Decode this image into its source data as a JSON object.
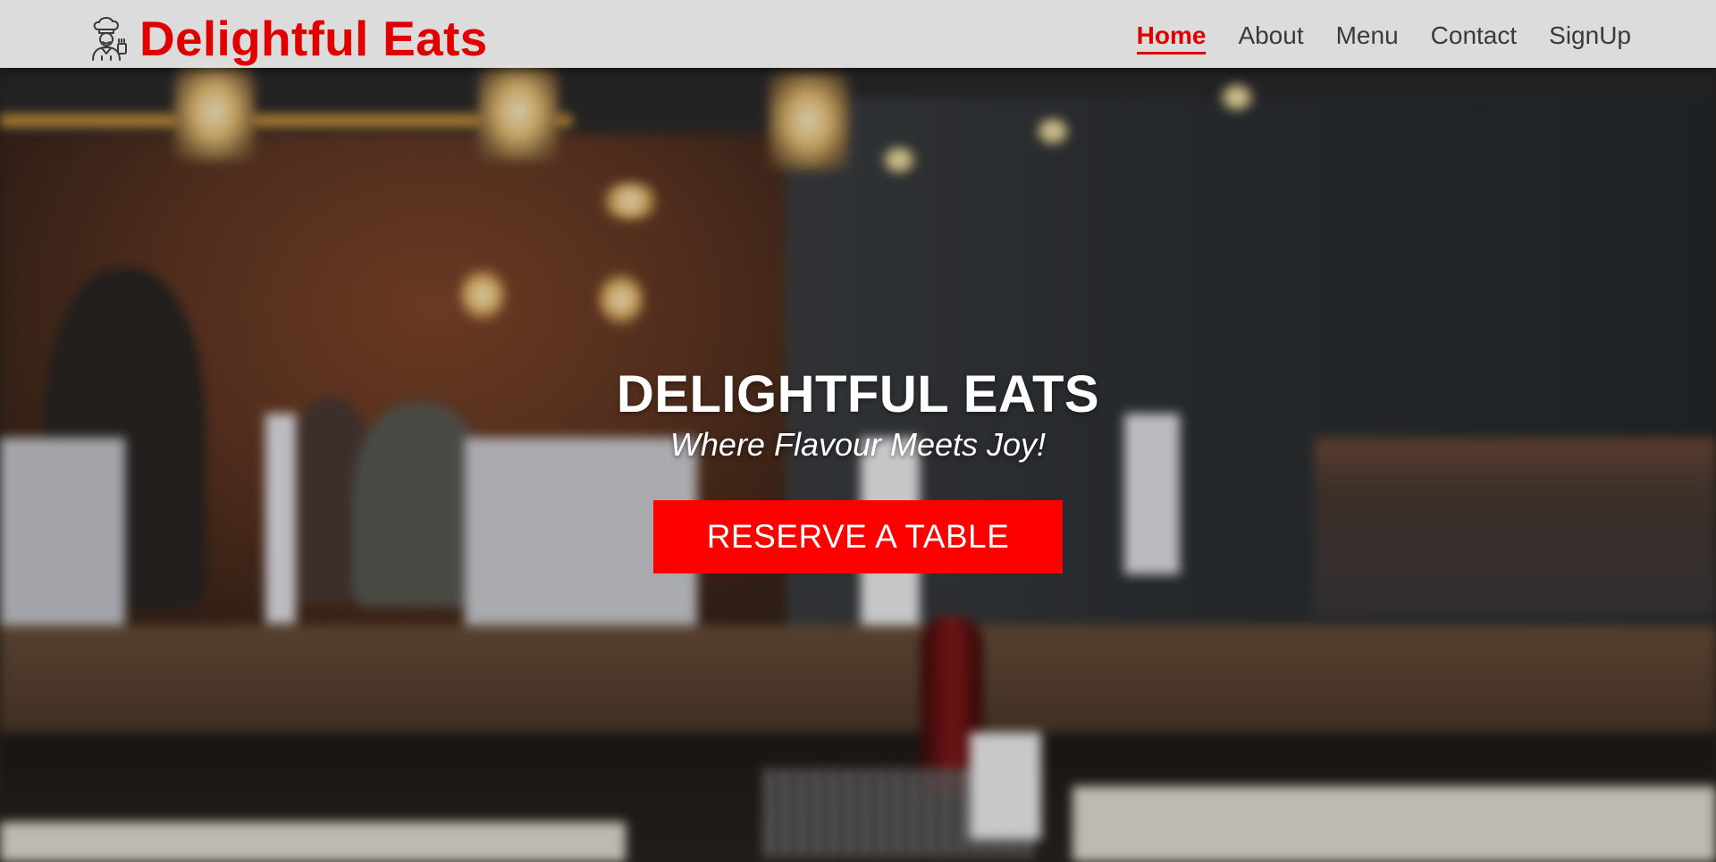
{
  "brand": {
    "name": "Delightful Eats",
    "logo_icon": "chef-icon"
  },
  "nav": {
    "items": [
      {
        "label": "Home",
        "active": true
      },
      {
        "label": "About",
        "active": false
      },
      {
        "label": "Menu",
        "active": false
      },
      {
        "label": "Contact",
        "active": false
      },
      {
        "label": "SignUp",
        "active": false
      }
    ]
  },
  "hero": {
    "title": "DELIGHTFUL EATS",
    "tagline": "Where Flavour Meets Joy!",
    "cta_label": "RESERVE A TABLE"
  },
  "colors": {
    "brand": "#e10000",
    "cta_background": "#ff0000",
    "navbar_background": "#e4e4e4",
    "hero_text": "#ffffff"
  }
}
